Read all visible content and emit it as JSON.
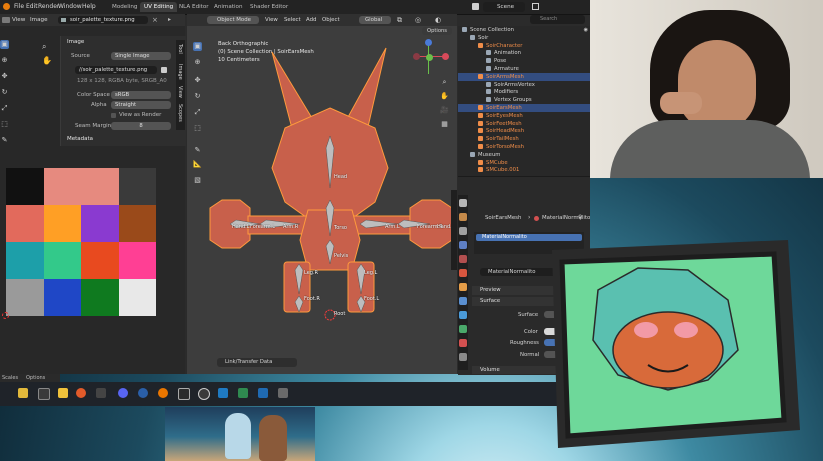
{
  "topbar": {
    "menus": [
      "File",
      "Edit",
      "Render",
      "Window",
      "Help"
    ],
    "workspaces": [
      "Modeling",
      "UV Editing",
      "NLA Editor",
      "Animation",
      "Shader Editor"
    ],
    "active_workspace": "UV Editing",
    "scene": "Scene"
  },
  "uv_editor": {
    "header": {
      "view": "View",
      "image": "Image",
      "image_name": "soir_palette_texture.png"
    },
    "panel_title": "Image",
    "source_label": "Source",
    "source_value": "Single Image",
    "filepath": "//soir_palette_texture.png",
    "info": "128 x 128, RGBA byte, SRGB_A0",
    "color_space_label": "Color Space",
    "color_space_value": "sRGB",
    "alpha_label": "Alpha",
    "alpha_value": "Straight",
    "view_as_render": "View as Render",
    "seam_margin_label": "Seam Margin",
    "seam_margin_value": "8",
    "metadata": "Metadata",
    "side_tabs": [
      "Tool",
      "Image",
      "View",
      "Scopes"
    ],
    "palette_colors": [
      "#111111",
      "#e68a7f",
      "#e68a7f",
      "#3a3a3a",
      "#e26a5c",
      "#ff9f25",
      "#8a3ad0",
      "#9a4a1a",
      "#1d9fa9",
      "#33c98a",
      "#e84a1f",
      "#ff3f94",
      "#9a9a9a",
      "#1f47c6",
      "#0f7a1f",
      "#e8e8e8"
    ],
    "footer": [
      "Scales",
      "Options"
    ]
  },
  "viewport": {
    "mode": "Object Mode",
    "menus": [
      "View",
      "Select",
      "Add",
      "Object"
    ],
    "orientation": "Global",
    "options": "Options",
    "info_line1": "Back Orthographic",
    "info_line2": "(0) Scene Collection | SoirEarsMesh",
    "info_line3": "10 Centimeters",
    "bone_labels": [
      "Head",
      "Torso",
      "Pelvis",
      "Hand.L",
      "Forearm.L",
      "Arm.R",
      "Arm.L",
      "Forearm.R",
      "Hand.R",
      "Leg.R",
      "Leg.L",
      "Foot.R",
      "Foot.L",
      "Root"
    ],
    "side_tabs": [
      "Tool",
      "Item",
      "View",
      "Animation"
    ],
    "bottom_button": "Link/Transfer Data"
  },
  "outliner": {
    "search_placeholder": "Search",
    "rows": [
      {
        "label": "Scene Collection",
        "indent": 0,
        "orange": false,
        "sel": false
      },
      {
        "label": "Soir",
        "indent": 1,
        "orange": false,
        "sel": false
      },
      {
        "label": "SoirCharacter",
        "indent": 2,
        "orange": true,
        "sel": false
      },
      {
        "label": "Animation",
        "indent": 3,
        "orange": false,
        "sel": false
      },
      {
        "label": "Pose",
        "indent": 3,
        "orange": false,
        "sel": false
      },
      {
        "label": "Armature",
        "indent": 3,
        "orange": false,
        "sel": false
      },
      {
        "label": "SoirArmsMesh",
        "indent": 2,
        "orange": true,
        "sel": true
      },
      {
        "label": "SoirArmsVertex",
        "indent": 3,
        "orange": false,
        "sel": false
      },
      {
        "label": "Modifiers",
        "indent": 3,
        "orange": false,
        "sel": false
      },
      {
        "label": "Vertex Groups",
        "indent": 3,
        "orange": false,
        "sel": false
      },
      {
        "label": "SoirEarsMesh",
        "indent": 2,
        "orange": true,
        "sel": true
      },
      {
        "label": "SoirEyesMesh",
        "indent": 2,
        "orange": true,
        "sel": false
      },
      {
        "label": "SoirFeetMesh",
        "indent": 2,
        "orange": true,
        "sel": false
      },
      {
        "label": "SoirHeadMesh",
        "indent": 2,
        "orange": true,
        "sel": false
      },
      {
        "label": "SoirTailMesh",
        "indent": 2,
        "orange": true,
        "sel": false
      },
      {
        "label": "SoirTorsoMesh",
        "indent": 2,
        "orange": true,
        "sel": false
      },
      {
        "label": "Museum",
        "indent": 1,
        "orange": false,
        "sel": false
      },
      {
        "label": "SMCube",
        "indent": 2,
        "orange": true,
        "sel": false
      },
      {
        "label": "SMCube.001",
        "indent": 2,
        "orange": true,
        "sel": false
      }
    ]
  },
  "properties": {
    "breadcrumb_object": "SoirEarsMesh",
    "breadcrumb_material": "MaterialNormalito",
    "slot": "MaterialNormalito",
    "material_field": "MaterialNormalito",
    "preview": "Preview",
    "surface_section": "Surface",
    "surface_label": "Surface",
    "color_label": "Color",
    "roughness_label": "Roughness",
    "normal_label": "Normal",
    "volume": "Volume"
  },
  "colors": {
    "accent": "#4772b3",
    "selected_row": "#334d80",
    "object_orange": "#f08d49",
    "mesh_fill": "#c8604b",
    "mesh_edge": "#ff9a3c",
    "tv_screen": "#6ed89a"
  }
}
